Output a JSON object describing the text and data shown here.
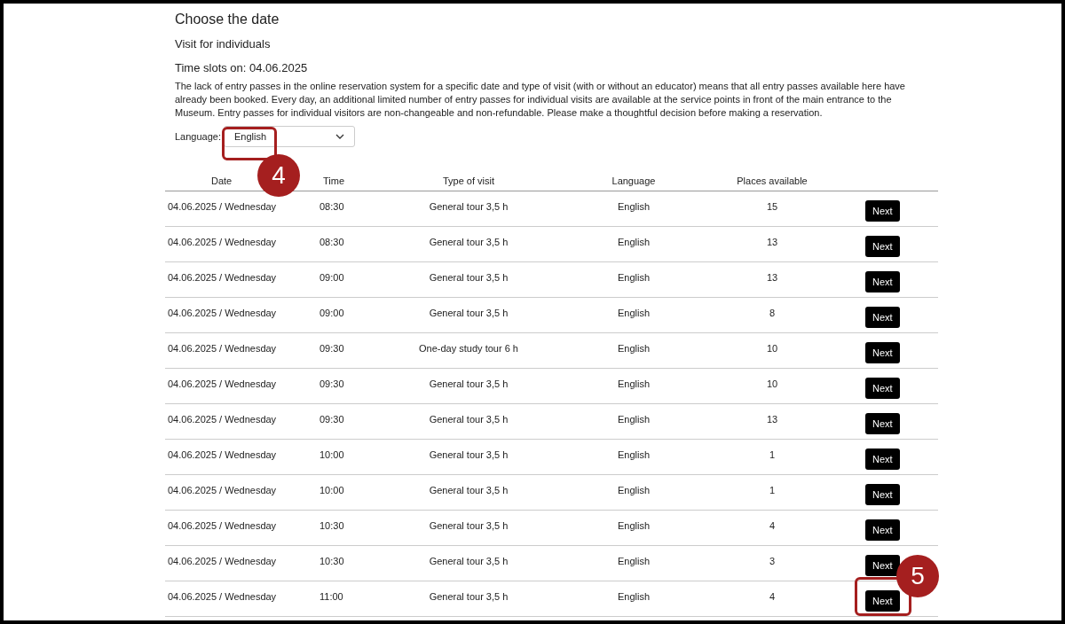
{
  "heading": "Choose the date",
  "subheading": "Visit for individuals",
  "time_slots_label": "Time slots on: 04.06.2025",
  "notice": "The lack of entry passes in the online reservation system for a specific date and type of visit (with or without an educator) means that all entry passes available here have already been booked. Every day, an additional limited number of entry passes for individual visits are available at the service points in front of the main entrance to the Museum. Entry passes for individual visitors are non-changeable and non-refundable. Please make a thoughtful decision before making a reservation.",
  "language_filter": {
    "label": "Language:",
    "value": "English"
  },
  "table": {
    "columns": [
      "Date",
      "Time",
      "Type of visit",
      "Language",
      "Places available"
    ],
    "rows": [
      {
        "date": "04.06.2025 / Wednesday",
        "time": "08:30",
        "type": "General tour 3,5 h",
        "language": "English",
        "places": "15",
        "button": "Next"
      },
      {
        "date": "04.06.2025 / Wednesday",
        "time": "08:30",
        "type": "General tour 3,5 h",
        "language": "English",
        "places": "13",
        "button": "Next"
      },
      {
        "date": "04.06.2025 / Wednesday",
        "time": "09:00",
        "type": "General tour 3,5 h",
        "language": "English",
        "places": "13",
        "button": "Next"
      },
      {
        "date": "04.06.2025 / Wednesday",
        "time": "09:00",
        "type": "General tour 3,5 h",
        "language": "English",
        "places": "8",
        "button": "Next"
      },
      {
        "date": "04.06.2025 / Wednesday",
        "time": "09:30",
        "type": "One-day study tour 6 h",
        "language": "English",
        "places": "10",
        "button": "Next"
      },
      {
        "date": "04.06.2025 / Wednesday",
        "time": "09:30",
        "type": "General tour 3,5 h",
        "language": "English",
        "places": "10",
        "button": "Next"
      },
      {
        "date": "04.06.2025 / Wednesday",
        "time": "09:30",
        "type": "General tour 3,5 h",
        "language": "English",
        "places": "13",
        "button": "Next"
      },
      {
        "date": "04.06.2025 / Wednesday",
        "time": "10:00",
        "type": "General tour 3,5 h",
        "language": "English",
        "places": "1",
        "button": "Next"
      },
      {
        "date": "04.06.2025 / Wednesday",
        "time": "10:00",
        "type": "General tour 3,5 h",
        "language": "English",
        "places": "1",
        "button": "Next"
      },
      {
        "date": "04.06.2025 / Wednesday",
        "time": "10:30",
        "type": "General tour 3,5 h",
        "language": "English",
        "places": "4",
        "button": "Next"
      },
      {
        "date": "04.06.2025 / Wednesday",
        "time": "10:30",
        "type": "General tour 3,5 h",
        "language": "English",
        "places": "3",
        "button": "Next"
      },
      {
        "date": "04.06.2025 / Wednesday",
        "time": "11:00",
        "type": "General tour 3,5 h",
        "language": "English",
        "places": "4",
        "button": "Next"
      }
    ]
  },
  "callouts": [
    {
      "number": "4"
    },
    {
      "number": "5"
    }
  ]
}
